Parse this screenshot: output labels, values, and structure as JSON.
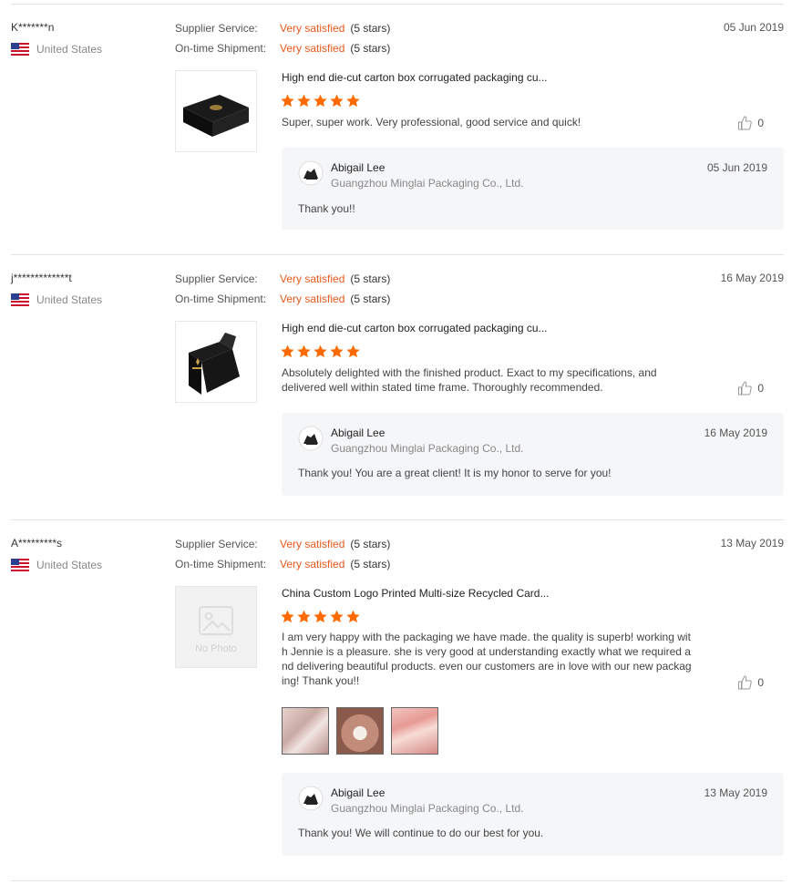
{
  "labels": {
    "supplier_service": "Supplier Service:",
    "ontime_shipment": "On-time Shipment:",
    "no_photo": "No Photo"
  },
  "reviews": [
    {
      "buyer": "K*******n",
      "country": "United States",
      "date": "05 Jun 2019",
      "supplier_rating": "Very satisfied",
      "supplier_stars": "(5 stars)",
      "shipment_rating": "Very satisfied",
      "shipment_stars": "(5 stars)",
      "product_title": "High end die-cut carton box corrugated packaging cu...",
      "rating": 5,
      "comment": "Super, super work. Very professional, good service and quick!",
      "likes": "0",
      "reply": {
        "name": "Abigail Lee",
        "company": "Guangzhou Minglai Packaging Co., Ltd.",
        "date": "05 Jun 2019",
        "text": "Thank you!!"
      }
    },
    {
      "buyer": "j*************t",
      "country": "United States",
      "date": "16 May 2019",
      "supplier_rating": "Very satisfied",
      "supplier_stars": "(5 stars)",
      "shipment_rating": "Very satisfied",
      "shipment_stars": "(5 stars)",
      "product_title": "High end die-cut carton box corrugated packaging cu...",
      "rating": 5,
      "comment": "Absolutely delighted with the finished product. Exact to my specifications, and delivered well within stated time frame. Thoroughly recommended.",
      "likes": "0",
      "reply": {
        "name": "Abigail Lee",
        "company": "Guangzhou Minglai Packaging Co., Ltd.",
        "date": "16 May 2019",
        "text": "Thank you! You are a great client! It is my honor to serve for you!"
      }
    },
    {
      "buyer": "A*********s",
      "country": "United States",
      "date": "13 May 2019",
      "supplier_rating": "Very satisfied",
      "supplier_stars": "(5 stars)",
      "shipment_rating": "Very satisfied",
      "shipment_stars": "(5 stars)",
      "product_title": "China Custom Logo Printed Multi-size Recycled Card...",
      "rating": 5,
      "comment": "I am very happy with the packaging we have made. the quality is superb! working with Jennie is a pleasure. she is very good at understanding exactly what we required and delivering beautiful products. even our customers are in love with our new packaging! Thank you!!",
      "likes": "0",
      "reply": {
        "name": "Abigail Lee",
        "company": "Guangzhou Minglai Packaging Co., Ltd.",
        "date": "13 May 2019",
        "text": "Thank you! We will continue to do our best for you."
      }
    }
  ],
  "colors": {
    "accent": "#e8581c",
    "star": "#ff6a00",
    "reply_bg": "#f5f6f8"
  },
  "icons": {
    "flag": "us-flag-icon",
    "like": "thumbs-up-icon",
    "star": "star-icon",
    "avatar": "supplier-avatar"
  }
}
